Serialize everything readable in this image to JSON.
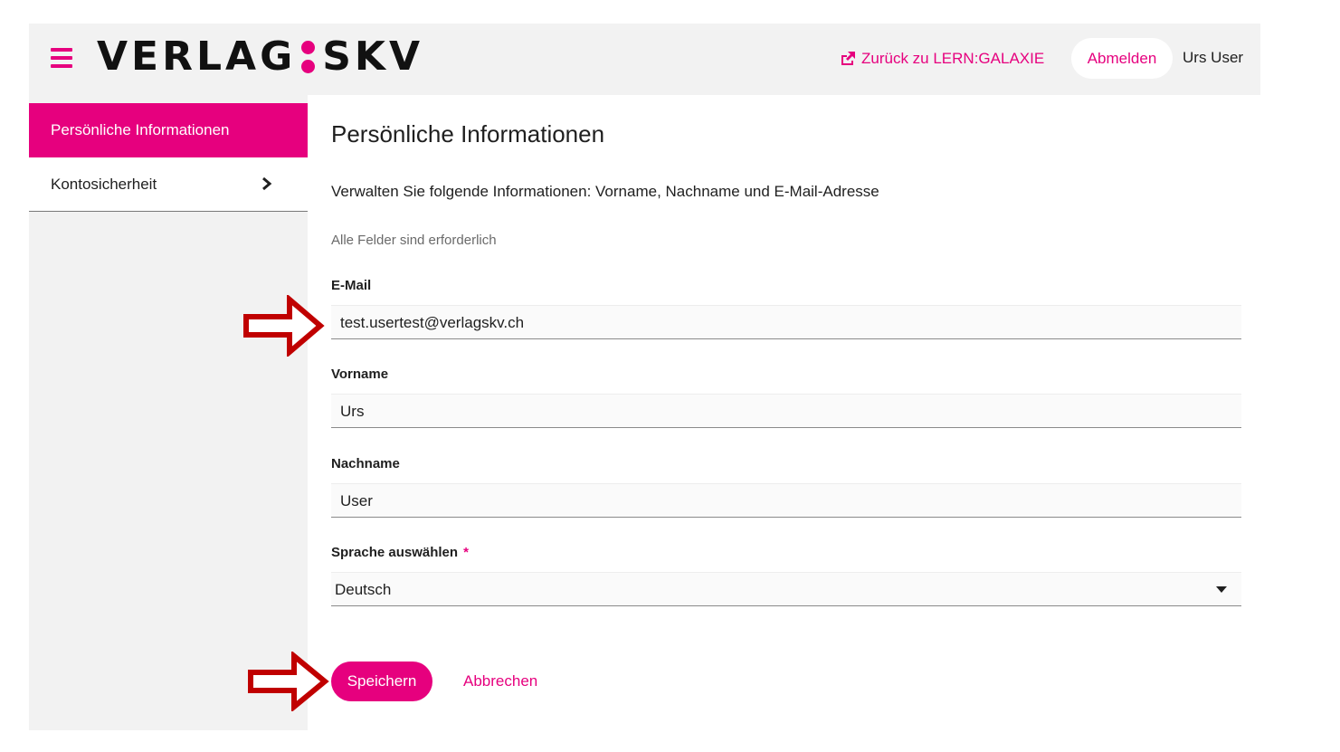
{
  "header": {
    "logo_left": "VERLAG",
    "logo_right": "SKV",
    "back_link_label": "Zurück zu LERN:GALAXIE",
    "logout_label": "Abmelden",
    "user_name": "Urs User",
    "icons": [
      "menu-icon",
      "external-link-icon"
    ]
  },
  "sidebar": {
    "items": [
      {
        "label": "Persönliche Informationen",
        "active": true
      },
      {
        "label": "Kontosicherheit",
        "active": false,
        "icon": "chevron-right-icon"
      }
    ]
  },
  "main": {
    "title": "Persönliche Informationen",
    "description": "Verwalten Sie folgende Informationen: Vorname, Nachname und E-Mail-Adresse",
    "required_note": "Alle Felder sind erforderlich",
    "fields": {
      "email": {
        "label": "E-Mail",
        "value": "test.usertest@verlagskv.ch"
      },
      "first_name": {
        "label": "Vorname",
        "value": "Urs"
      },
      "last_name": {
        "label": "Nachname",
        "value": "User"
      },
      "language": {
        "label": "Sprache auswählen",
        "required_mark": "*",
        "value": "Deutsch"
      }
    },
    "save_label": "Speichern",
    "cancel_label": "Abbrechen"
  },
  "colors": {
    "accent": "#e6007e",
    "annotation_arrow": "#c00000",
    "panel_bg": "#f2f2f2"
  }
}
